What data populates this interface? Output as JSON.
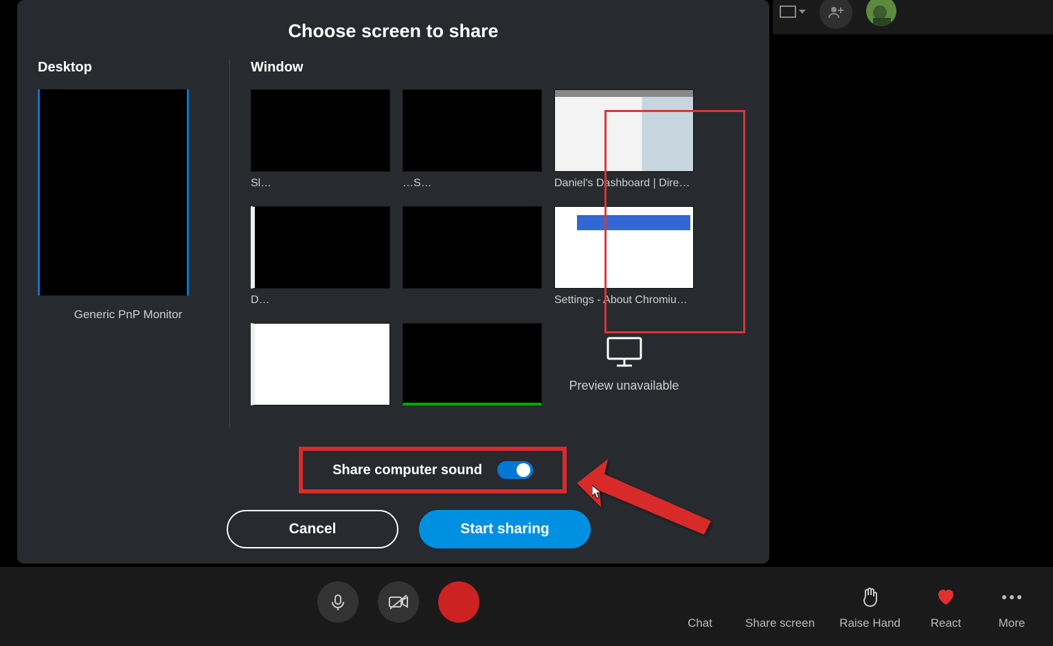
{
  "dialog": {
    "title": "Choose screen to share",
    "desktop_header": "Desktop",
    "window_header": "Window",
    "desktop": {
      "label": "Generic PnP Monitor"
    },
    "windows": [
      {
        "label": "Sl…"
      },
      {
        "label": "…S…"
      },
      {
        "label": "Daniel's Dashboard | Direct…"
      },
      {
        "label": "D…"
      },
      {
        "label": ""
      },
      {
        "label": "Settings - About Chromiu…"
      },
      {
        "label": ""
      },
      {
        "label": ""
      },
      {
        "label": "Preview unavailable"
      }
    ],
    "share_sound_label": "Share computer sound",
    "share_sound_on": true,
    "cancel_label": "Cancel",
    "start_label": "Start sharing"
  },
  "bottom": {
    "chat": "Chat",
    "share_screen": "Share screen",
    "raise_hand": "Raise Hand",
    "react": "React",
    "more": "More"
  }
}
